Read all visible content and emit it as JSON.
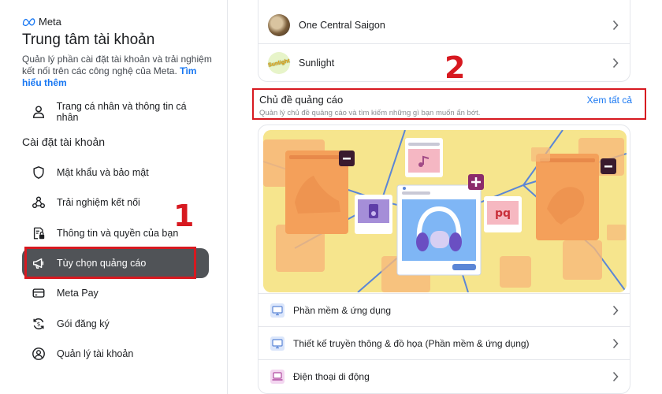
{
  "sidebar": {
    "logo_text": "Meta",
    "title": "Trung tâm tài khoản",
    "description": "Quản lý phần cài đặt tài khoản và trải nghiệm kết nối trên các công nghệ của Meta.",
    "learn_more": "Tìm hiểu thêm",
    "profile_item": "Trang cá nhân và thông tin cá nhân",
    "section_label": "Cài đặt tài khoản",
    "items": [
      {
        "label": "Mật khẩu và bảo mật",
        "icon": "shield-icon"
      },
      {
        "label": "Trải nghiệm kết nối",
        "icon": "connected-icon"
      },
      {
        "label": "Thông tin và quyền của bạn",
        "icon": "info-lock-icon"
      },
      {
        "label": "Tùy chọn quảng cáo",
        "icon": "megaphone-icon",
        "active": true
      },
      {
        "label": "Meta Pay",
        "icon": "card-icon"
      },
      {
        "label": "Gói đăng ký",
        "icon": "subscription-icon"
      },
      {
        "label": "Quản lý tài khoản",
        "icon": "account-icon"
      }
    ]
  },
  "main": {
    "advertisers": [
      {
        "name": "One Central Saigon"
      },
      {
        "name": "Sunlight",
        "thumb_text": "Sunlight"
      }
    ],
    "topics": {
      "title": "Chủ đề quảng cáo",
      "subtitle": "Quản lý chủ đề quảng cáo và tìm kiếm những gì bạn muốn ẩn bớt.",
      "see_all": "Xem tất cả",
      "illustration_text": "pq",
      "rows": [
        {
          "label": "Phần mềm & ứng dụng"
        },
        {
          "label": "Thiết kế truyền thông & đồ họa (Phần mềm & ứng dụng)"
        },
        {
          "label": "Điện thoại di động"
        }
      ]
    }
  },
  "annotations": {
    "one": "1",
    "two": "2",
    "color": "#d71920"
  },
  "colors": {
    "accent": "#1877f2",
    "active_bg": "#505357",
    "illustration_bg": "#f6e58d"
  }
}
